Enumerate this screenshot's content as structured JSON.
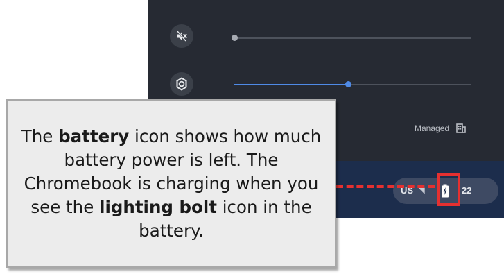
{
  "quick_settings": {
    "managed_label": "Managed",
    "volume": {
      "level": 0.0
    },
    "brightness": {
      "level": 0.48
    }
  },
  "shelf": {
    "ime_label": "US",
    "time_fragment": "22"
  },
  "callout": {
    "t1": "The ",
    "b1": "battery",
    "t2": " icon shows how much battery power is left. The Chromebook is charging when you see the ",
    "b2": "lighting bolt",
    "t3": " icon in the battery."
  },
  "colors": {
    "panel_bg": "#262a33",
    "shelf_bg": "#1c2d4c",
    "accent_blue": "#4f8ae6",
    "highlight_red": "#e53030"
  },
  "icons": [
    "volume-muted-icon",
    "brightness-icon",
    "managed-building-icon",
    "battery-charging-icon"
  ]
}
